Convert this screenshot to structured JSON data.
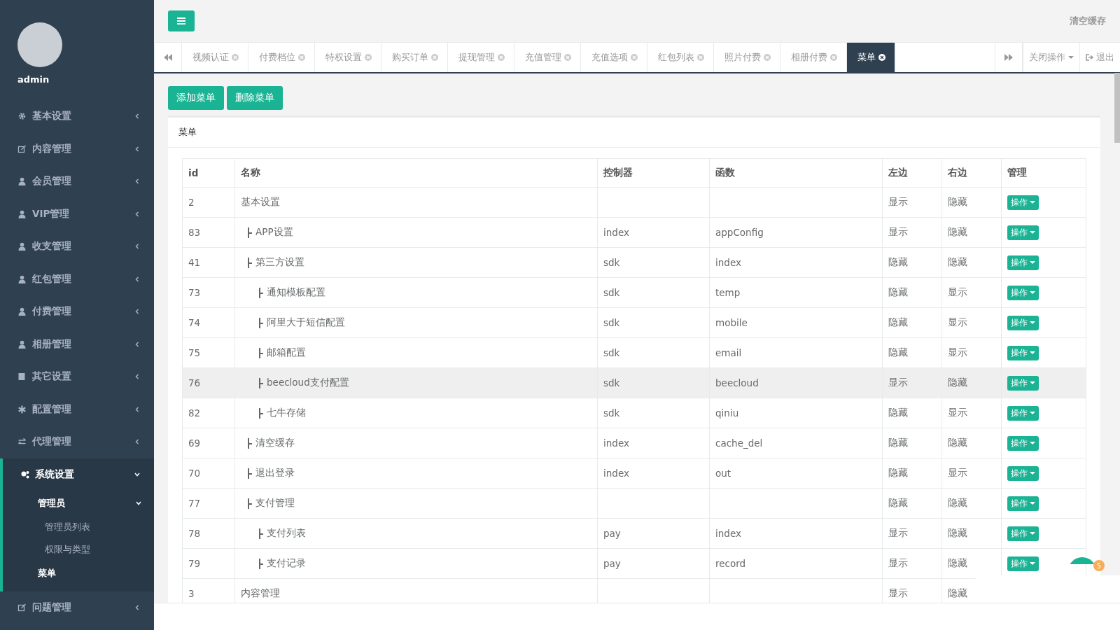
{
  "sidebar": {
    "user": "admin",
    "items": [
      {
        "label": "基本设置",
        "kind": "gear",
        "expanded": false
      },
      {
        "label": "内容管理",
        "kind": "edit",
        "expanded": false
      },
      {
        "label": "会员管理",
        "kind": "user",
        "expanded": false
      },
      {
        "label": "VIP管理",
        "kind": "user",
        "expanded": false
      },
      {
        "label": "收支管理",
        "kind": "user",
        "expanded": false
      },
      {
        "label": "红包管理",
        "kind": "user",
        "expanded": false
      },
      {
        "label": "付费管理",
        "kind": "user",
        "expanded": false
      },
      {
        "label": "相册管理",
        "kind": "user",
        "expanded": false
      },
      {
        "label": "其它设置",
        "kind": "book",
        "expanded": false
      },
      {
        "label": "配置管理",
        "kind": "asterisk",
        "expanded": false
      },
      {
        "label": "代理管理",
        "kind": "exchange",
        "expanded": false
      },
      {
        "label": "系统设置",
        "kind": "cogs",
        "expanded": true,
        "children": [
          {
            "label": "管理员",
            "expanded": true,
            "children": [
              {
                "label": "管理员列表",
                "selected": false
              },
              {
                "label": "权限与类型",
                "selected": false
              }
            ]
          },
          {
            "label": "菜单",
            "selected": true
          }
        ]
      },
      {
        "label": "问题管理",
        "kind": "edit",
        "expanded": false
      }
    ]
  },
  "topbar": {
    "clear_cache": "清空缓存"
  },
  "tabs": [
    {
      "label": "视频认证",
      "selected": false
    },
    {
      "label": "付费档位",
      "selected": false
    },
    {
      "label": "特权设置",
      "selected": false
    },
    {
      "label": "购买订单",
      "selected": false
    },
    {
      "label": "提现管理",
      "selected": false
    },
    {
      "label": "充值管理",
      "selected": false
    },
    {
      "label": "充值选项",
      "selected": false
    },
    {
      "label": "红包列表",
      "selected": false
    },
    {
      "label": "照片付费",
      "selected": false
    },
    {
      "label": "相册付费",
      "selected": false
    },
    {
      "label": "菜单",
      "selected": true
    }
  ],
  "tab_actions": {
    "close_menu": "关闭操作",
    "logout": "退出"
  },
  "buttons": [
    "添加菜单",
    "删除菜单"
  ],
  "panel": {
    "title": "菜单"
  },
  "table": {
    "columns": [
      "id",
      "名称",
      "控制器",
      "函数",
      "左边",
      "右边",
      "管理"
    ],
    "rows": [
      {
        "id": "2",
        "name": "基本设置",
        "left": "显示",
        "right": "隐藏",
        "action": "操作",
        "selected": false,
        "children": [
          {
            "id": "83",
            "name": "APP设置",
            "controller": "index",
            "function": "appConfig",
            "left": "显示",
            "right": "隐藏",
            "action": "操作",
            "selected": false
          },
          {
            "id": "41",
            "name": "第三方设置",
            "controller": "sdk",
            "function": "index",
            "left": "隐藏",
            "right": "隐藏",
            "action": "操作",
            "selected": false,
            "children": [
              {
                "id": "73",
                "name": "通知模板配置",
                "controller": "sdk",
                "function": "temp",
                "left": "隐藏",
                "right": "显示",
                "action": "操作",
                "selected": false
              },
              {
                "id": "74",
                "name": "阿里大于短信配置",
                "controller": "sdk",
                "function": "mobile",
                "left": "隐藏",
                "right": "显示",
                "action": "操作",
                "selected": false
              },
              {
                "id": "75",
                "name": "邮箱配置",
                "controller": "sdk",
                "function": "email",
                "left": "隐藏",
                "right": "显示",
                "action": "操作",
                "selected": false
              },
              {
                "id": "76",
                "name": "beecloud支付配置",
                "controller": "sdk",
                "function": "beecloud",
                "left": "显示",
                "right": "隐藏",
                "action": "操作",
                "selected": true
              },
              {
                "id": "82",
                "name": "七牛存储",
                "controller": "sdk",
                "function": "qiniu",
                "left": "隐藏",
                "right": "显示",
                "action": "操作",
                "selected": false
              }
            ]
          },
          {
            "id": "69",
            "name": "清空缓存",
            "controller": "index",
            "function": "cache_del",
            "left": "隐藏",
            "right": "隐藏",
            "action": "操作",
            "selected": false
          },
          {
            "id": "70",
            "name": "退出登录",
            "controller": "index",
            "function": "out",
            "left": "隐藏",
            "right": "显示",
            "action": "操作",
            "selected": false
          },
          {
            "id": "77",
            "name": "支付管理",
            "left": "隐藏",
            "right": "隐藏",
            "action": "操作",
            "selected": false,
            "children": [
              {
                "id": "78",
                "name": "支付列表",
                "controller": "pay",
                "function": "index",
                "left": "显示",
                "right": "隐藏",
                "action": "操作",
                "selected": false
              },
              {
                "id": "79",
                "name": "支付记录",
                "controller": "pay",
                "function": "record",
                "left": "显示",
                "right": "隐藏",
                "action": "操作",
                "selected": false
              }
            ]
          }
        ]
      },
      {
        "id": "3",
        "name": "内容管理",
        "left": "显示",
        "right": "隐藏",
        "selected": false
      }
    ]
  },
  "chat": {
    "badge": "5"
  }
}
